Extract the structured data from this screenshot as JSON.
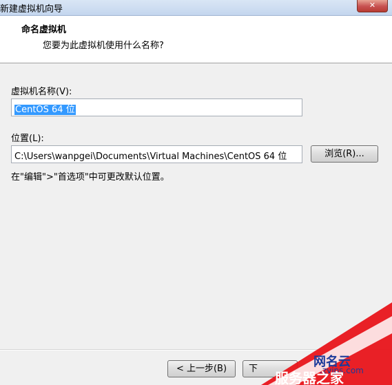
{
  "window": {
    "title": "新建虚拟机向导",
    "close_glyph": "✕"
  },
  "header": {
    "title": "命名虚拟机",
    "subtitle": "您要为此虚拟机使用什么名称?"
  },
  "name_field": {
    "label": "虚拟机名称(V):",
    "value": "CentOS 64 位"
  },
  "location_field": {
    "label": "位置(L):",
    "value": "C:\\Users\\wanpgei\\Documents\\Virtual Machines\\CentOS 64 位"
  },
  "browse_button": {
    "label": "浏览(R)..."
  },
  "hint": "在\"编辑\">\"首选项\"中可更改默认位置。",
  "footer": {
    "back_label": "< 上一步(B)",
    "next_label": "下"
  },
  "watermark": {
    "line1": "网名云",
    "line2": "服务器之家",
    "url": ".zvips.com"
  },
  "colors": {
    "selection": "#3399ff",
    "watermark_red": "#e8141a",
    "watermark_blue": "#1b3a9a"
  }
}
